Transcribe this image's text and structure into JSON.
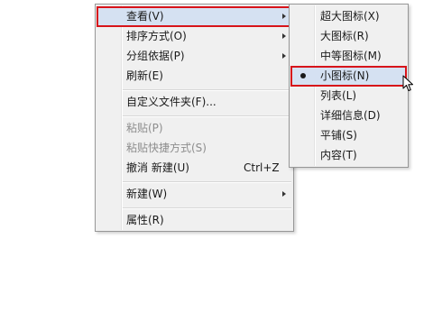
{
  "main_menu": {
    "items": [
      {
        "label": "查看(V)"
      },
      {
        "label": "排序方式(O)"
      },
      {
        "label": "分组依据(P)"
      },
      {
        "label": "刷新(E)"
      },
      {
        "label": "自定义文件夹(F)..."
      },
      {
        "label": "粘贴(P)"
      },
      {
        "label": "粘贴快捷方式(S)"
      },
      {
        "label": "撤消 新建(U)",
        "shortcut": "Ctrl+Z"
      },
      {
        "label": "新建(W)"
      },
      {
        "label": "属性(R)"
      }
    ]
  },
  "view_submenu": {
    "items": [
      {
        "label": "超大图标(X)"
      },
      {
        "label": "大图标(R)"
      },
      {
        "label": "中等图标(M)"
      },
      {
        "label": "小图标(N)"
      },
      {
        "label": "列表(L)"
      },
      {
        "label": "详细信息(D)"
      },
      {
        "label": "平铺(S)"
      },
      {
        "label": "内容(T)"
      }
    ]
  },
  "colors": {
    "menu_bg": "#f0f0f0",
    "highlight_bg": "#d5e1f2",
    "annotation_red": "#d7141a",
    "disabled_text": "#8d8d8d"
  },
  "icons": {
    "submenu_arrow": "chevron-right-icon",
    "selected_marker": "radio-bullet-icon",
    "pointer": "mouse-pointer-icon"
  }
}
